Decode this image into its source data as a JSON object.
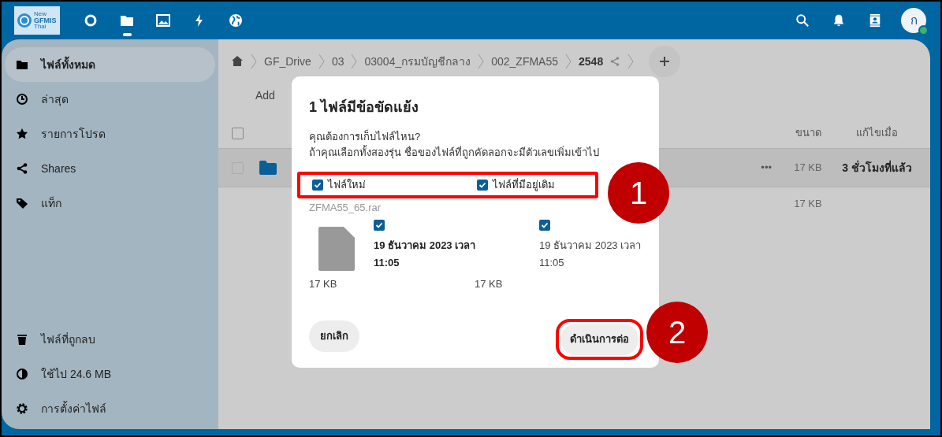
{
  "header": {
    "logo_text": [
      "New",
      "GFMIS",
      "Thai"
    ],
    "apps": [
      {
        "kind": "dashboard",
        "selected": false
      },
      {
        "kind": "files",
        "selected": true
      },
      {
        "kind": "photos",
        "selected": false
      },
      {
        "kind": "activity",
        "selected": false
      },
      {
        "kind": "globe",
        "selected": false
      }
    ],
    "avatar": {
      "initial": "ก",
      "online": true
    }
  },
  "sidebar": {
    "items": [
      {
        "label": "ไฟล์ทั้งหมด",
        "selected": true
      },
      {
        "label": "ล่าสุด",
        "selected": false
      },
      {
        "label": "รายการโปรด",
        "selected": false
      },
      {
        "label": "Shares",
        "selected": false
      },
      {
        "label": "แท็ก",
        "selected": false
      }
    ],
    "footer": [
      {
        "label": "ไฟล์ที่ถูกลบ"
      },
      {
        "label": "ใช้ไป 24.6 MB"
      },
      {
        "label": "การตั้งค่าไฟล์"
      }
    ]
  },
  "breadcrumbs": [
    {
      "label": "GF_Drive",
      "current": false
    },
    {
      "label": "03",
      "current": false
    },
    {
      "label": "03004_กรมบัญชีกลาง",
      "current": false
    },
    {
      "label": "002_ZFMA55",
      "current": false
    },
    {
      "label": "2548",
      "current": true
    }
  ],
  "toolbar": {
    "text": "Add"
  },
  "table": {
    "select_all": {
      "checked": false
    },
    "columns": {
      "size": "ขนาด",
      "modified": "แก้ไขเมื่อ"
    },
    "rows": [
      {
        "checked": false,
        "actions": "•••",
        "size": "17 KB",
        "modified": "3 ชั่วโมงที่แล้ว",
        "highlighted": true
      }
    ],
    "summary": {
      "size": "17 KB"
    }
  },
  "dialog": {
    "title": "1 ไฟล์มีข้อขัดแย้ง",
    "question": "คุณต้องการเก็บไฟล์ไหน?",
    "hint": "ถ้าคุณเลือกทั้งสองรุ่น ชื่อของไฟล์ที่ถูกคัดลอกจะมีตัวเลขเพิ่มเข้าไป",
    "options": [
      {
        "label": "ไฟล์ใหม่",
        "checked": true
      },
      {
        "label": "ไฟล์ที่มีอยู่เดิม",
        "checked": true
      }
    ],
    "file": {
      "name": "ZFMA55_65.rar",
      "versions": [
        {
          "kind": "new",
          "checked": true,
          "date": "19 ธันวาคม 2023 เวลา",
          "time": "11:05",
          "size": "17 KB"
        },
        {
          "kind": "existing",
          "checked": true,
          "date": "19 ธันวาคม 2023 เวลา",
          "time": "11:05",
          "size": "17 KB"
        }
      ]
    },
    "cancel": "ยกเลิก",
    "continue": "ดำเนินการต่อ"
  },
  "annotations": [
    {
      "label": "1"
    },
    {
      "label": "2"
    }
  ]
}
